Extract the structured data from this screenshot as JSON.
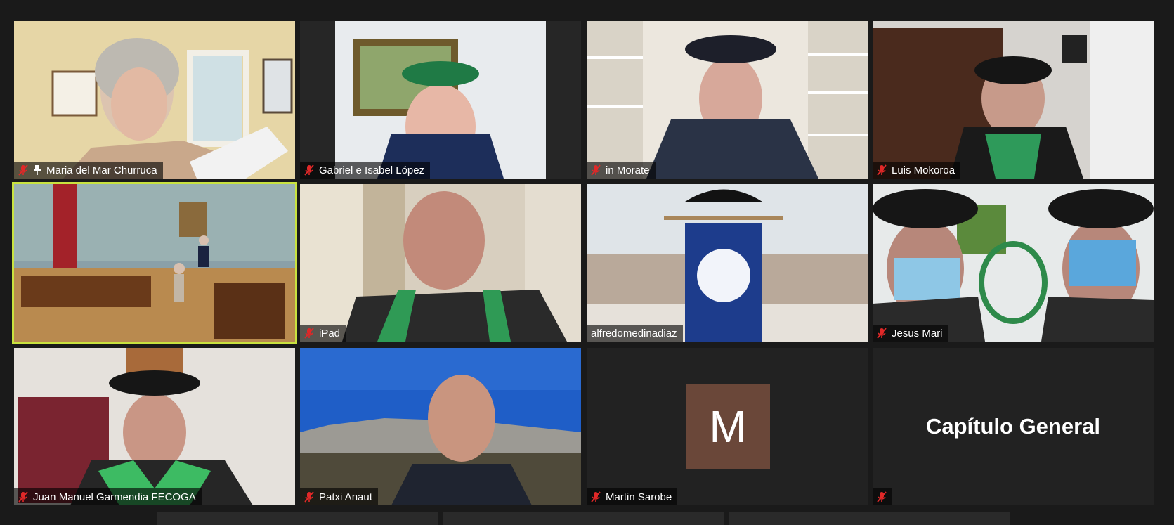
{
  "participants": [
    {
      "name": "Maria del Mar Churruca",
      "pinned": true,
      "muted": true
    },
    {
      "name": "Gabriel e Isabel López",
      "muted": true
    },
    {
      "name": "in Morate",
      "muted": true
    },
    {
      "name": "Luis Mokoroa",
      "muted": true
    },
    {
      "name": "",
      "muted": false,
      "active_speaker": true
    },
    {
      "name": "iPad",
      "muted": true
    },
    {
      "name": "alfredomedinadiaz",
      "muted": false
    },
    {
      "name": "Jesus Mari",
      "muted": true
    },
    {
      "name": "Juan Manuel Garmendia FECOGA",
      "muted": true
    },
    {
      "name": "Patxi Anaut",
      "muted": true
    },
    {
      "name": "Martin Sarobe",
      "muted": true,
      "avatar_letter": "M"
    },
    {
      "name": "",
      "muted": true,
      "display_text": "Capítulo General"
    }
  ],
  "colors": {
    "active_border": "#c9e23f",
    "muted_icon": "#e02828",
    "avatar_bg": "#6a4739"
  },
  "icons": {
    "mic_muted": "mic-muted-icon",
    "pin": "pin-icon"
  }
}
